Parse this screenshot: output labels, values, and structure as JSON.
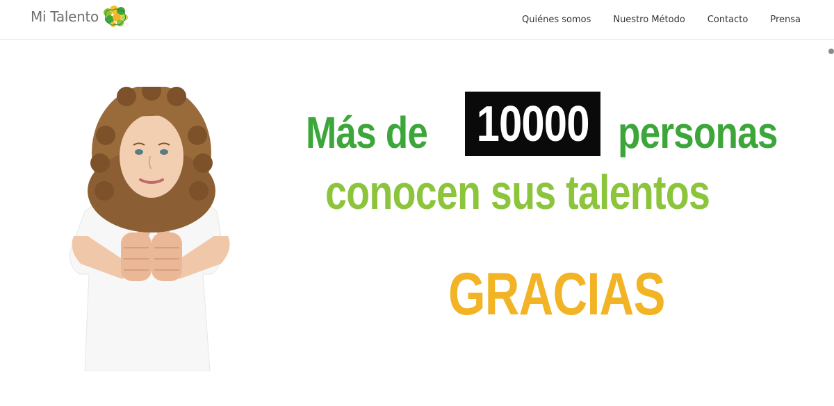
{
  "header": {
    "logo_text": "Mi Talento",
    "nav": [
      {
        "label": "Quiénes somos"
      },
      {
        "label": "Nuestro Método"
      },
      {
        "label": "Contacto"
      },
      {
        "label": "Prensa"
      }
    ]
  },
  "hero": {
    "line1_prefix": "Más de",
    "number": "10000",
    "line1_suffix": "personas",
    "line2": "conocen sus talentos",
    "thanks": "GRACIAS"
  },
  "colors": {
    "green_dark": "#3ca63a",
    "green_light": "#8cc43c",
    "yellow": "#f2b324",
    "number_box": "#0a0a0a"
  }
}
